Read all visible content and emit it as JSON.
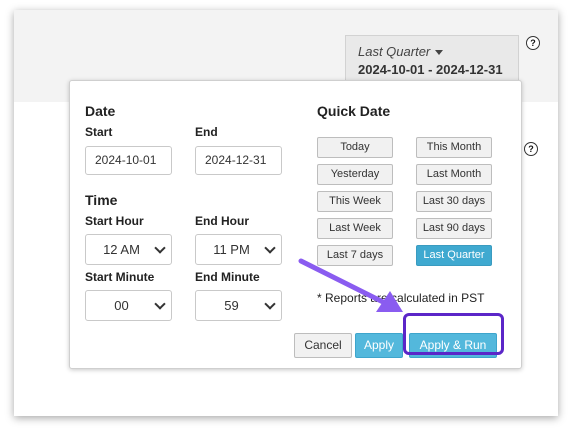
{
  "header": {
    "range_label": "Last Quarter",
    "range_dates": "2024-10-01 - 2024-12-31",
    "help_glyph": "?"
  },
  "date": {
    "heading": "Date",
    "start_label": "Start",
    "start_value": "2024-10-01",
    "end_label": "End",
    "end_value": "2024-12-31"
  },
  "time": {
    "heading": "Time",
    "start_hour_label": "Start Hour",
    "start_hour_value": "12 AM",
    "end_hour_label": "End Hour",
    "end_hour_value": "11 PM",
    "start_minute_label": "Start Minute",
    "start_minute_value": "00",
    "end_minute_label": "End Minute",
    "end_minute_value": "59"
  },
  "quick_date": {
    "heading": "Quick Date",
    "buttons": [
      {
        "label": "Today"
      },
      {
        "label": "This Month"
      },
      {
        "label": "Yesterday"
      },
      {
        "label": "Last Month"
      },
      {
        "label": "This Week"
      },
      {
        "label": "Last 30 days"
      },
      {
        "label": "Last Week"
      },
      {
        "label": "Last 90 days"
      },
      {
        "label": "Last 7 days"
      },
      {
        "label": "Last Quarter"
      }
    ],
    "active": "Last Quarter"
  },
  "note": "* Reports are calculated in PST",
  "actions": {
    "cancel": "Cancel",
    "apply": "Apply",
    "apply_run": "Apply & Run"
  },
  "colors": {
    "accent": "#3fa9d0",
    "highlight": "#5b26c8",
    "arrow": "#8a5cf0"
  }
}
